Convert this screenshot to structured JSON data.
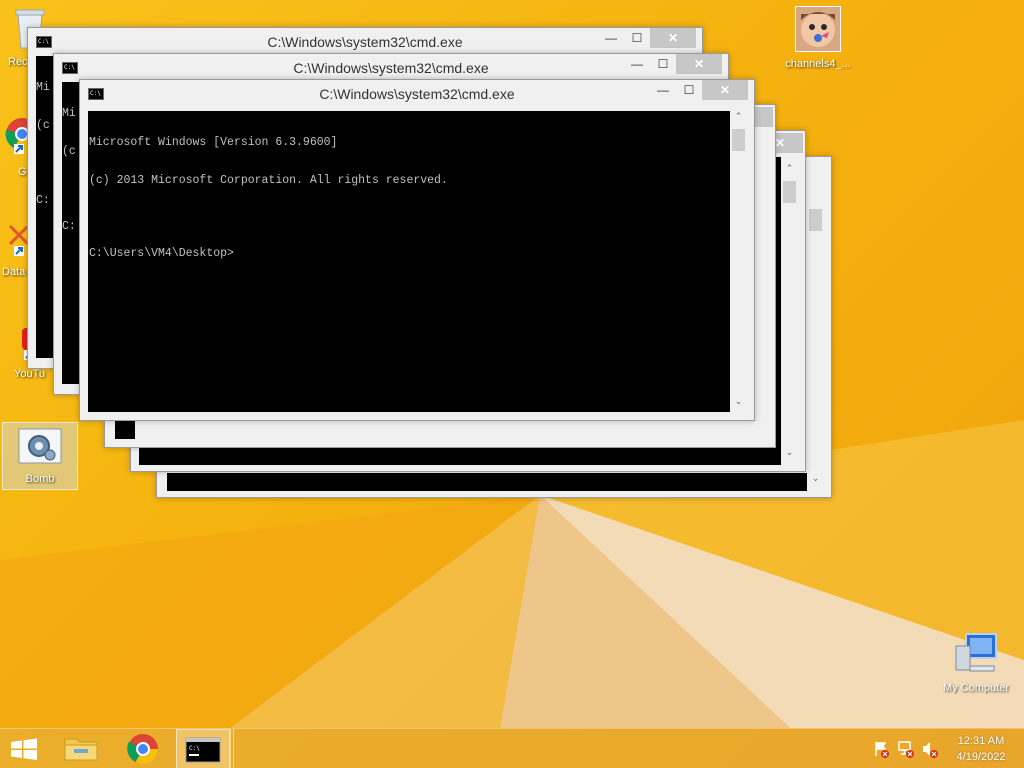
{
  "desktop": {
    "icons_left": [
      {
        "label": "Rec"
      },
      {
        "label": "G"
      },
      {
        "label": "Data"
      },
      {
        "label": "YouTu"
      },
      {
        "label": "Bomb"
      }
    ],
    "icons_right": [
      {
        "label": "channels4_..."
      },
      {
        "label": "My Computer"
      }
    ]
  },
  "windows": [
    {
      "title": "C:\\Windows\\system32\\cmd.exe",
      "minimize": "—",
      "maximize": "☐",
      "close": "✕",
      "console_lines": [
        "Mi",
        "(c",
        "",
        "C:"
      ]
    },
    {
      "title": "C:\\Windows\\system32\\cmd.exe",
      "minimize": "—",
      "maximize": "☐",
      "close": "✕",
      "console_lines": [
        "Mi",
        "(c",
        "",
        "C:"
      ]
    },
    {
      "title": "C:\\Windows\\system32\\cmd.exe",
      "minimize": "—",
      "maximize": "☐",
      "close": "✕",
      "console_lines": [
        "Microsoft Windows [Version 6.3.9600]",
        "(c) 2013 Microsoft Corporation. All rights reserved.",
        "",
        "C:\\Users\\VM4\\Desktop>"
      ]
    }
  ],
  "taskbar": {
    "start_icon": "windows-logo",
    "pinned": [
      "file-explorer-icon",
      "chrome-icon",
      "cmd-icon"
    ],
    "clock_time": "12:31 AM",
    "clock_date": "4/19/2022"
  },
  "colors": {
    "wallpaper": "#f5b20f",
    "console_bg": "#000000",
    "console_fg": "#c0c0c0",
    "close_button": "#c7c7c7"
  }
}
